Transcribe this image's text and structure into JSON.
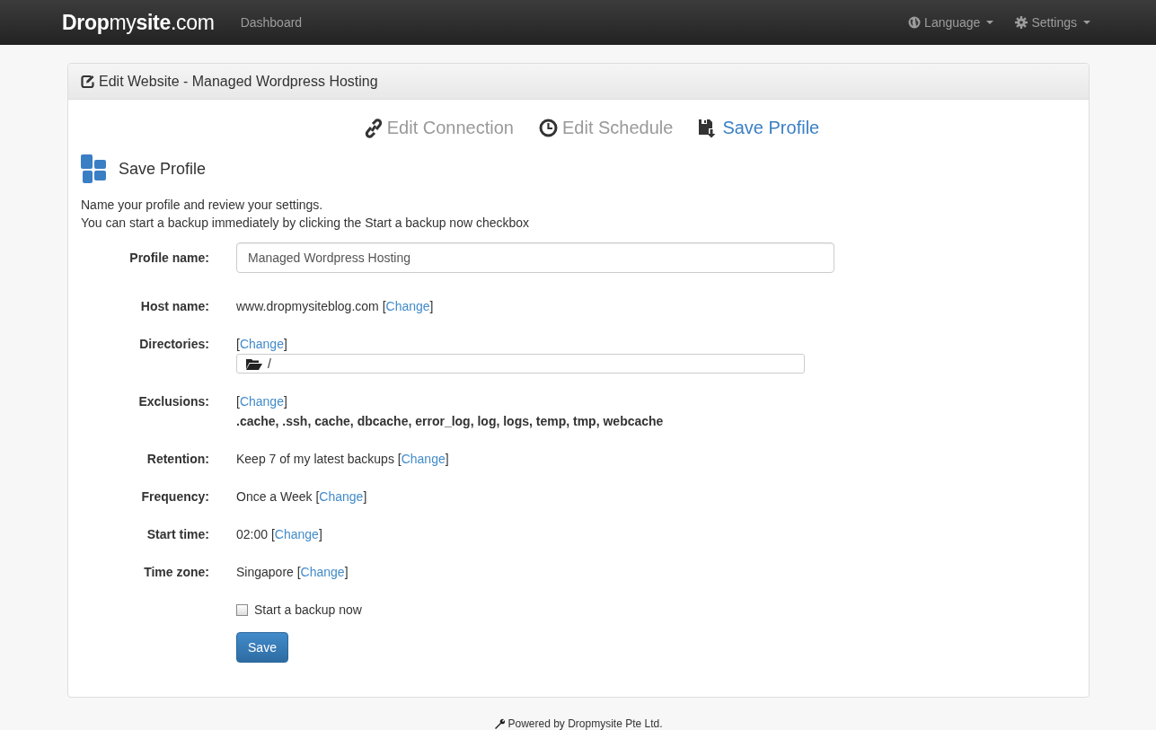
{
  "navbar": {
    "logo": "**Drop**my**site**.com",
    "links": [
      {
        "label": "Dashboard",
        "kind": "plain"
      }
    ],
    "menus": [
      {
        "label": "Language",
        "kind": "globe"
      },
      {
        "label": "Settings",
        "kind": "gear"
      }
    ]
  },
  "panel": {
    "title": "Edit Website - Managed Wordpress Hosting",
    "steps": [
      {
        "label": "Edit Connection",
        "kind": "link",
        "selected": false
      },
      {
        "label": "Edit Schedule",
        "kind": "clock",
        "selected": false
      },
      {
        "label": "Save Profile",
        "kind": "save",
        "selected": true
      }
    ],
    "section_title": "Save Profile",
    "intro": [
      "Name your profile and review your settings.",
      "You can start a backup immediately by clicking the Start a backup now checkbox"
    ],
    "fields": [
      {
        "kind": "input",
        "label": "Profile name:",
        "value": "Managed Wordpress Hosting"
      },
      {
        "kind": "text",
        "label": "Host name:",
        "value": "www.dropmysiteblog.com",
        "change": {
          "open": "[",
          "label": "Change",
          "close": "]"
        }
      },
      {
        "kind": "directory",
        "label": "Directories:",
        "value": "/",
        "change": {
          "open": "[",
          "label": "Change",
          "close": "]"
        }
      },
      {
        "kind": "list",
        "label": "Exclusions:",
        "value": ".cache, .ssh, cache, dbcache, error_log, log, logs, temp, tmp, webcache",
        "change": {
          "open": "[",
          "label": "Change",
          "close": "]"
        }
      },
      {
        "kind": "text",
        "label": "Retention:",
        "value": "Keep 7 of my latest backups",
        "change": {
          "open": "[",
          "label": "Change",
          "close": "]"
        }
      },
      {
        "kind": "text",
        "label": "Frequency:",
        "value": "Once a Week",
        "change": {
          "open": "[",
          "label": "Change",
          "close": "]"
        }
      },
      {
        "kind": "text",
        "label": "Start time:",
        "value": "02:00",
        "change": {
          "open": "[",
          "label": "Change",
          "close": "]"
        }
      },
      {
        "kind": "text",
        "label": "Time zone:",
        "value": "Singapore",
        "change": {
          "open": "[",
          "label": "Change",
          "close": "]"
        }
      }
    ],
    "backup_now": {
      "label": "Start a backup now",
      "checked": false
    },
    "save_button": "Save"
  },
  "footer": "Powered by Dropmysite Pte Ltd."
}
